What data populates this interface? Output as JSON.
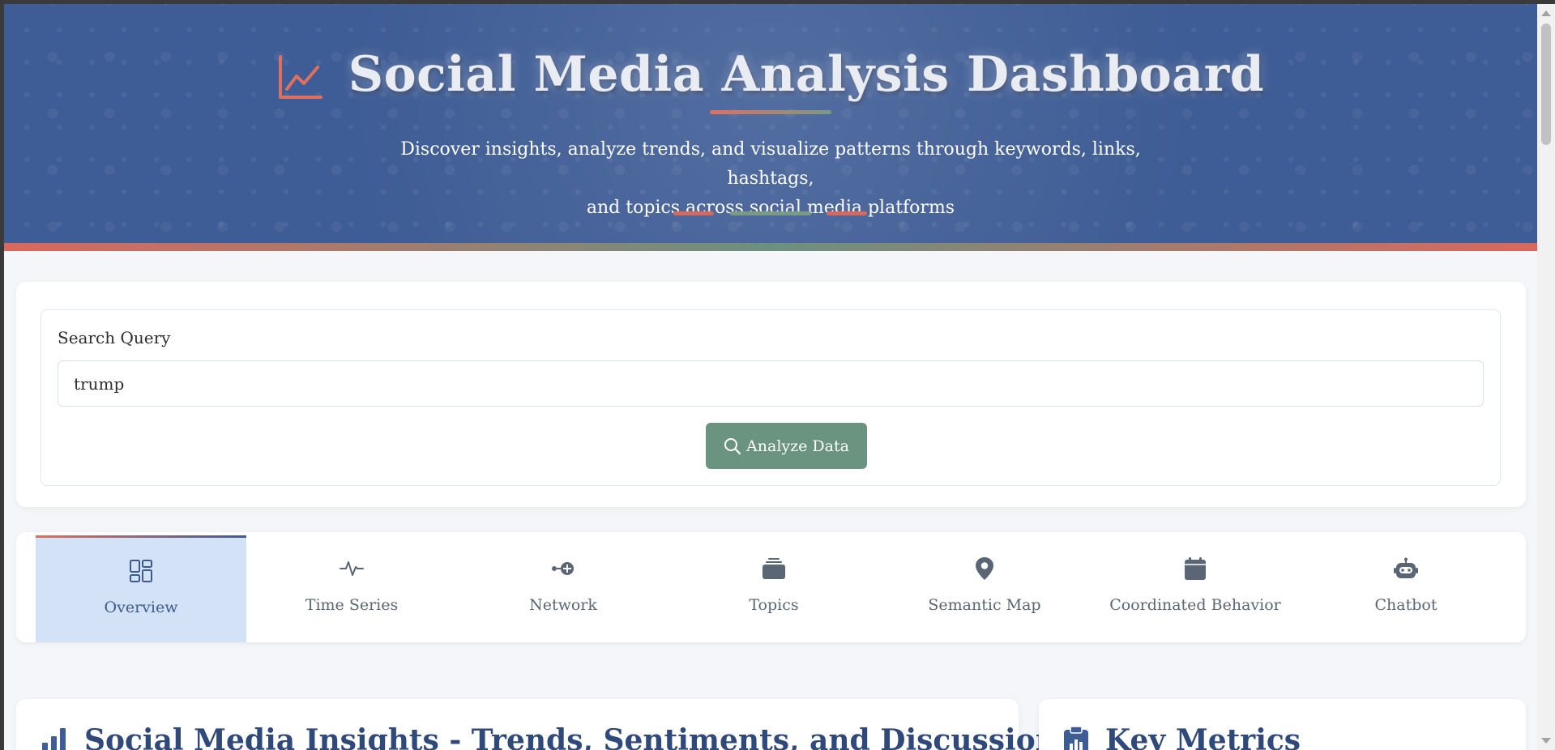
{
  "header": {
    "title": "Social Media Analysis Dashboard",
    "title_icon": "chart-line-icon",
    "subtitle_line1": "Discover insights, analyze trends, and visualize patterns through keywords, links, hashtags,",
    "subtitle_line2": "and topics across social media platforms"
  },
  "search": {
    "label": "Search Query",
    "value": "trump",
    "placeholder": "",
    "button_label": "Analyze Data",
    "button_icon": "search-icon"
  },
  "tabs": [
    {
      "label": "Overview",
      "icon": "overview-grid-icon",
      "active": true
    },
    {
      "label": "Time Series",
      "icon": "pulse-icon",
      "active": false
    },
    {
      "label": "Network",
      "icon": "network-icon",
      "active": false
    },
    {
      "label": "Topics",
      "icon": "layers-icon",
      "active": false
    },
    {
      "label": "Semantic Map",
      "icon": "map-pin-icon",
      "active": false
    },
    {
      "label": "Coordinated Behavior",
      "icon": "calendar-icon",
      "active": false
    },
    {
      "label": "Chatbot",
      "icon": "robot-icon",
      "active": false
    }
  ],
  "sections": {
    "insights_title": "Social Media Insights - Trends, Sentiments, and Discussions",
    "insights_icon": "bar-chart-icon",
    "metrics_title": "Key Metrics",
    "metrics_icon": "clipboard-icon"
  },
  "colors": {
    "header_bg": "#3e5c95",
    "accent_coral": "#e0705e",
    "accent_green": "#6a9480",
    "tab_active_bg": "#d4e2f7",
    "heading": "#2f4a7a"
  }
}
